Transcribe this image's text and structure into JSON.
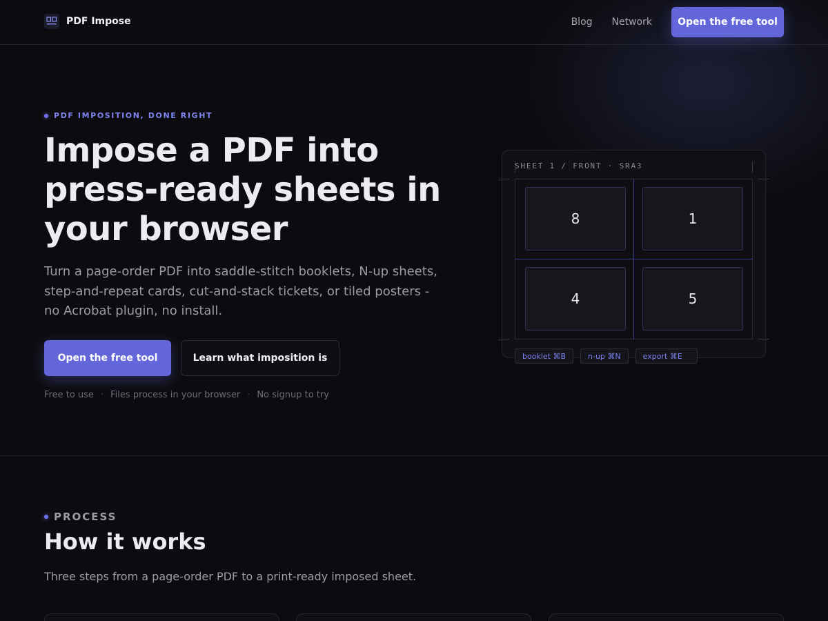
{
  "header": {
    "brand_name": "PDF Impose",
    "nav": [
      {
        "label": "Blog"
      },
      {
        "label": "Network"
      }
    ],
    "cta_label": "Open the free tool"
  },
  "hero": {
    "eyebrow": "PDF IMPOSITION, DONE RIGHT",
    "title": "Impose a PDF into press-ready sheets in your browser",
    "description": "Turn a page-order PDF into saddle-stitch booklets, N-up sheets, step-and-repeat cards, cut-and-stack tickets, or tiled posters - no Acrobat plugin, no install.",
    "primary_button": "Open the free tool",
    "secondary_button": "Learn what imposition is",
    "trust": [
      "Free to use",
      "Files process in your browser",
      "No signup to try"
    ],
    "trust_separator": "·"
  },
  "sheet_preview": {
    "label": "SHEET 1 / FRONT · SRA3",
    "pages": [
      "8",
      "1",
      "4",
      "5"
    ],
    "chips": [
      "booklet ⌘B",
      "n-up ⌘N",
      "export ⌘E"
    ]
  },
  "process": {
    "eyebrow": "PROCESS",
    "title": "How it works",
    "description": "Three steps from a page-order PDF to a print-ready imposed sheet."
  },
  "colors": {
    "background": "#0c0c10",
    "accent": "#6366d9",
    "accent_text": "#7d83ee"
  }
}
